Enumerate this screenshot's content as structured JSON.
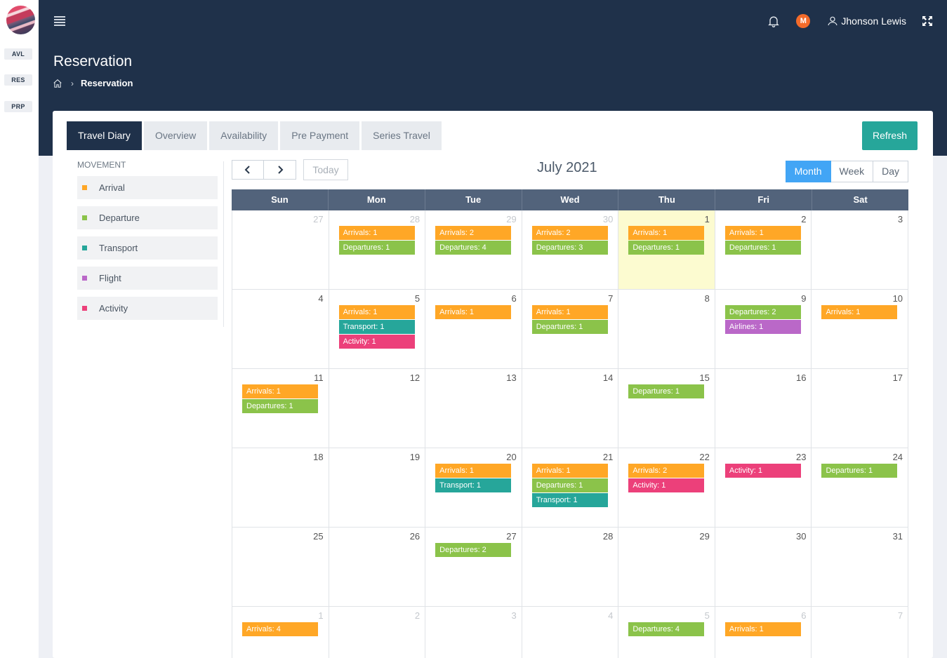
{
  "sidebar": {
    "items": [
      "AVL",
      "RES",
      "PRP"
    ]
  },
  "topbar": {
    "user_name": "Jhonson Lewis",
    "avatar_initial": "M"
  },
  "page": {
    "title": "Reservation",
    "breadcrumb": "Reservation"
  },
  "tabs": [
    "Travel Diary",
    "Overview",
    "Availability",
    "Pre Payment",
    "Series Travel"
  ],
  "refresh_label": "Refresh",
  "legend": {
    "title": "MOVEMENT",
    "items": [
      {
        "label": "Arrival",
        "color": "#ffa726"
      },
      {
        "label": "Departure",
        "color": "#8bc34a"
      },
      {
        "label": "Transport",
        "color": "#26a69a"
      },
      {
        "label": "Flight",
        "color": "#ba68c8"
      },
      {
        "label": "Activity",
        "color": "#ec407a"
      }
    ]
  },
  "calendar": {
    "title": "July 2021",
    "today_label": "Today",
    "views": [
      "Month",
      "Week",
      "Day"
    ],
    "active_view": "Month",
    "weekdays": [
      "Sun",
      "Mon",
      "Tue",
      "Wed",
      "Thu",
      "Fri",
      "Sat"
    ],
    "weeks": [
      [
        {
          "day": "27",
          "other": true,
          "events": []
        },
        {
          "day": "28",
          "other": true,
          "events": [
            {
              "type": "arrival",
              "label": "Arrivals: 1"
            },
            {
              "type": "departure",
              "label": "Departures: 1"
            }
          ]
        },
        {
          "day": "29",
          "other": true,
          "events": [
            {
              "type": "arrival",
              "label": "Arrivals: 2"
            },
            {
              "type": "departure",
              "label": "Departures: 4"
            }
          ]
        },
        {
          "day": "30",
          "other": true,
          "events": [
            {
              "type": "arrival",
              "label": "Arrivals: 2"
            },
            {
              "type": "departure",
              "label": "Departures: 3"
            }
          ]
        },
        {
          "day": "1",
          "today": true,
          "events": [
            {
              "type": "arrival",
              "label": "Arrivals: 1"
            },
            {
              "type": "departure",
              "label": "Departures: 1"
            }
          ]
        },
        {
          "day": "2",
          "events": [
            {
              "type": "arrival",
              "label": "Arrivals: 1"
            },
            {
              "type": "departure",
              "label": "Departures: 1"
            }
          ]
        },
        {
          "day": "3",
          "events": []
        }
      ],
      [
        {
          "day": "4",
          "events": []
        },
        {
          "day": "5",
          "events": [
            {
              "type": "arrival",
              "label": "Arrivals: 1"
            },
            {
              "type": "transport",
              "label": "Transport: 1"
            },
            {
              "type": "activity",
              "label": "Activity: 1"
            }
          ]
        },
        {
          "day": "6",
          "events": [
            {
              "type": "arrival",
              "label": "Arrivals: 1"
            }
          ]
        },
        {
          "day": "7",
          "events": [
            {
              "type": "arrival",
              "label": "Arrivals: 1"
            },
            {
              "type": "departure",
              "label": "Departures: 1"
            }
          ]
        },
        {
          "day": "8",
          "events": []
        },
        {
          "day": "9",
          "events": [
            {
              "type": "departure",
              "label": "Departures: 2"
            },
            {
              "type": "flight",
              "label": "Airlines: 1"
            }
          ]
        },
        {
          "day": "10",
          "events": [
            {
              "type": "arrival",
              "label": "Arrivals: 1"
            }
          ]
        }
      ],
      [
        {
          "day": "11",
          "events": [
            {
              "type": "arrival",
              "label": "Arrivals: 1"
            },
            {
              "type": "departure",
              "label": "Departures: 1"
            }
          ]
        },
        {
          "day": "12",
          "events": []
        },
        {
          "day": "13",
          "events": []
        },
        {
          "day": "14",
          "events": []
        },
        {
          "day": "15",
          "events": [
            {
              "type": "departure",
              "label": "Departures: 1"
            }
          ]
        },
        {
          "day": "16",
          "events": []
        },
        {
          "day": "17",
          "events": []
        }
      ],
      [
        {
          "day": "18",
          "events": []
        },
        {
          "day": "19",
          "events": []
        },
        {
          "day": "20",
          "events": [
            {
              "type": "arrival",
              "label": "Arrivals: 1"
            },
            {
              "type": "transport",
              "label": "Transport: 1"
            }
          ]
        },
        {
          "day": "21",
          "events": [
            {
              "type": "arrival",
              "label": "Arrivals: 1"
            },
            {
              "type": "departure",
              "label": "Departures: 1"
            },
            {
              "type": "transport",
              "label": "Transport: 1"
            }
          ]
        },
        {
          "day": "22",
          "events": [
            {
              "type": "arrival",
              "label": "Arrivals: 2"
            },
            {
              "type": "activity",
              "label": "Activity: 1"
            }
          ]
        },
        {
          "day": "23",
          "events": [
            {
              "type": "activity",
              "label": "Activity: 1"
            }
          ]
        },
        {
          "day": "24",
          "events": [
            {
              "type": "departure",
              "label": "Departures: 1"
            }
          ]
        }
      ],
      [
        {
          "day": "25",
          "events": []
        },
        {
          "day": "26",
          "events": []
        },
        {
          "day": "27",
          "events": [
            {
              "type": "departure",
              "label": "Departures: 2"
            }
          ]
        },
        {
          "day": "28",
          "events": []
        },
        {
          "day": "29",
          "events": []
        },
        {
          "day": "30",
          "events": []
        },
        {
          "day": "31",
          "events": []
        }
      ],
      [
        {
          "day": "1",
          "other": true,
          "events": [
            {
              "type": "arrival",
              "label": "Arrivals: 4"
            }
          ]
        },
        {
          "day": "2",
          "other": true,
          "events": []
        },
        {
          "day": "3",
          "other": true,
          "events": []
        },
        {
          "day": "4",
          "other": true,
          "events": []
        },
        {
          "day": "5",
          "other": true,
          "events": [
            {
              "type": "departure",
              "label": "Departures: 4"
            }
          ]
        },
        {
          "day": "6",
          "other": true,
          "events": [
            {
              "type": "arrival",
              "label": "Arrivals: 1"
            }
          ]
        },
        {
          "day": "7",
          "other": true,
          "events": []
        }
      ]
    ]
  }
}
